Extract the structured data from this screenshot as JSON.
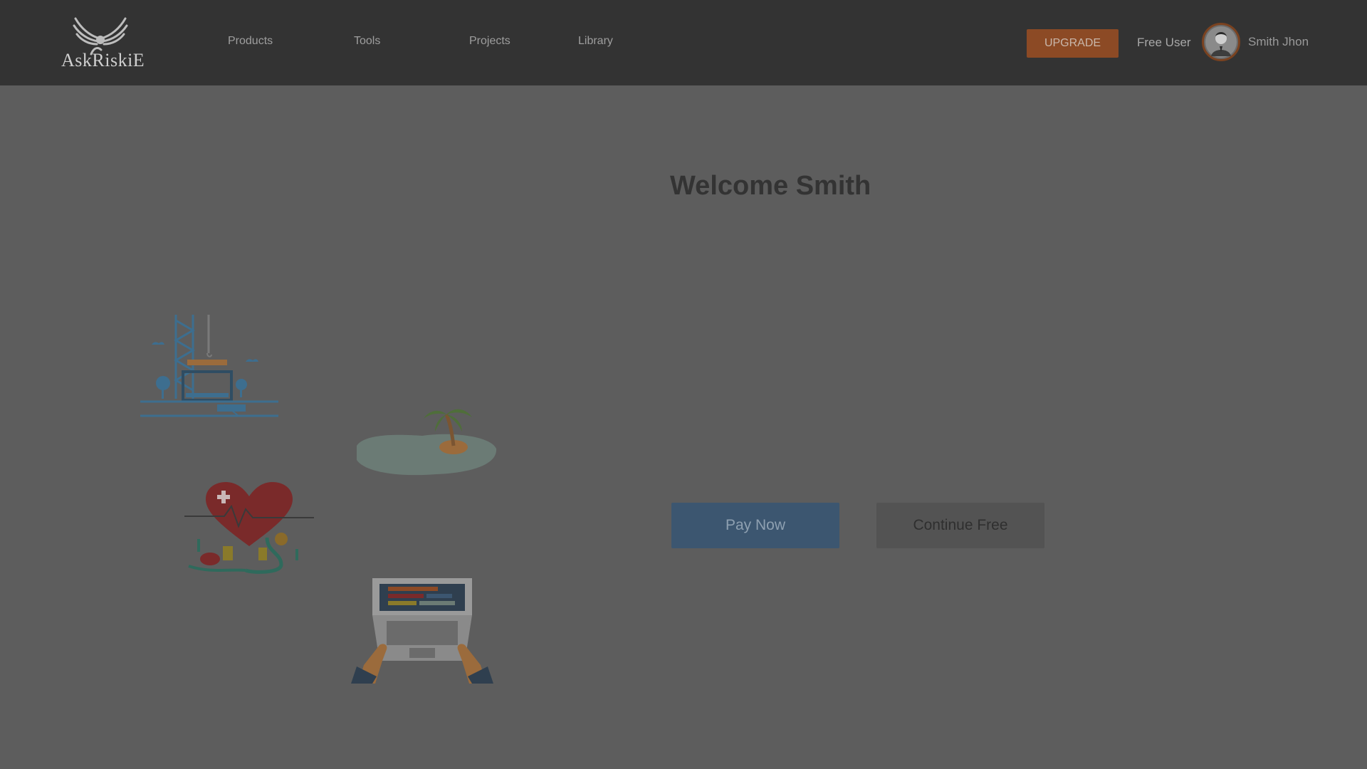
{
  "header": {
    "logo_text": "AskRiskiE",
    "nav": [
      "Products",
      "Tools",
      "Projects",
      "Library"
    ],
    "upgrade_label": "UPGRADE",
    "plan_label": "Free User",
    "user_name": "Smith Jhon"
  },
  "main": {
    "welcome": "Welcome Smith",
    "pay_label": "Pay Now",
    "continue_label": "Continue Free"
  },
  "icons": {
    "logo": "winged-logo-icon",
    "avatar": "user-avatar-icon",
    "illustrations": [
      "construction-tower-illustration",
      "palm-island-illustration",
      "health-heart-illustration",
      "laptop-hands-illustration"
    ]
  },
  "colors": {
    "header_bg": "#333333",
    "overlay_bg": "#5d5d5d",
    "upgrade": "#8c4a25",
    "pay": "#3c5670",
    "continue": "#535353"
  }
}
